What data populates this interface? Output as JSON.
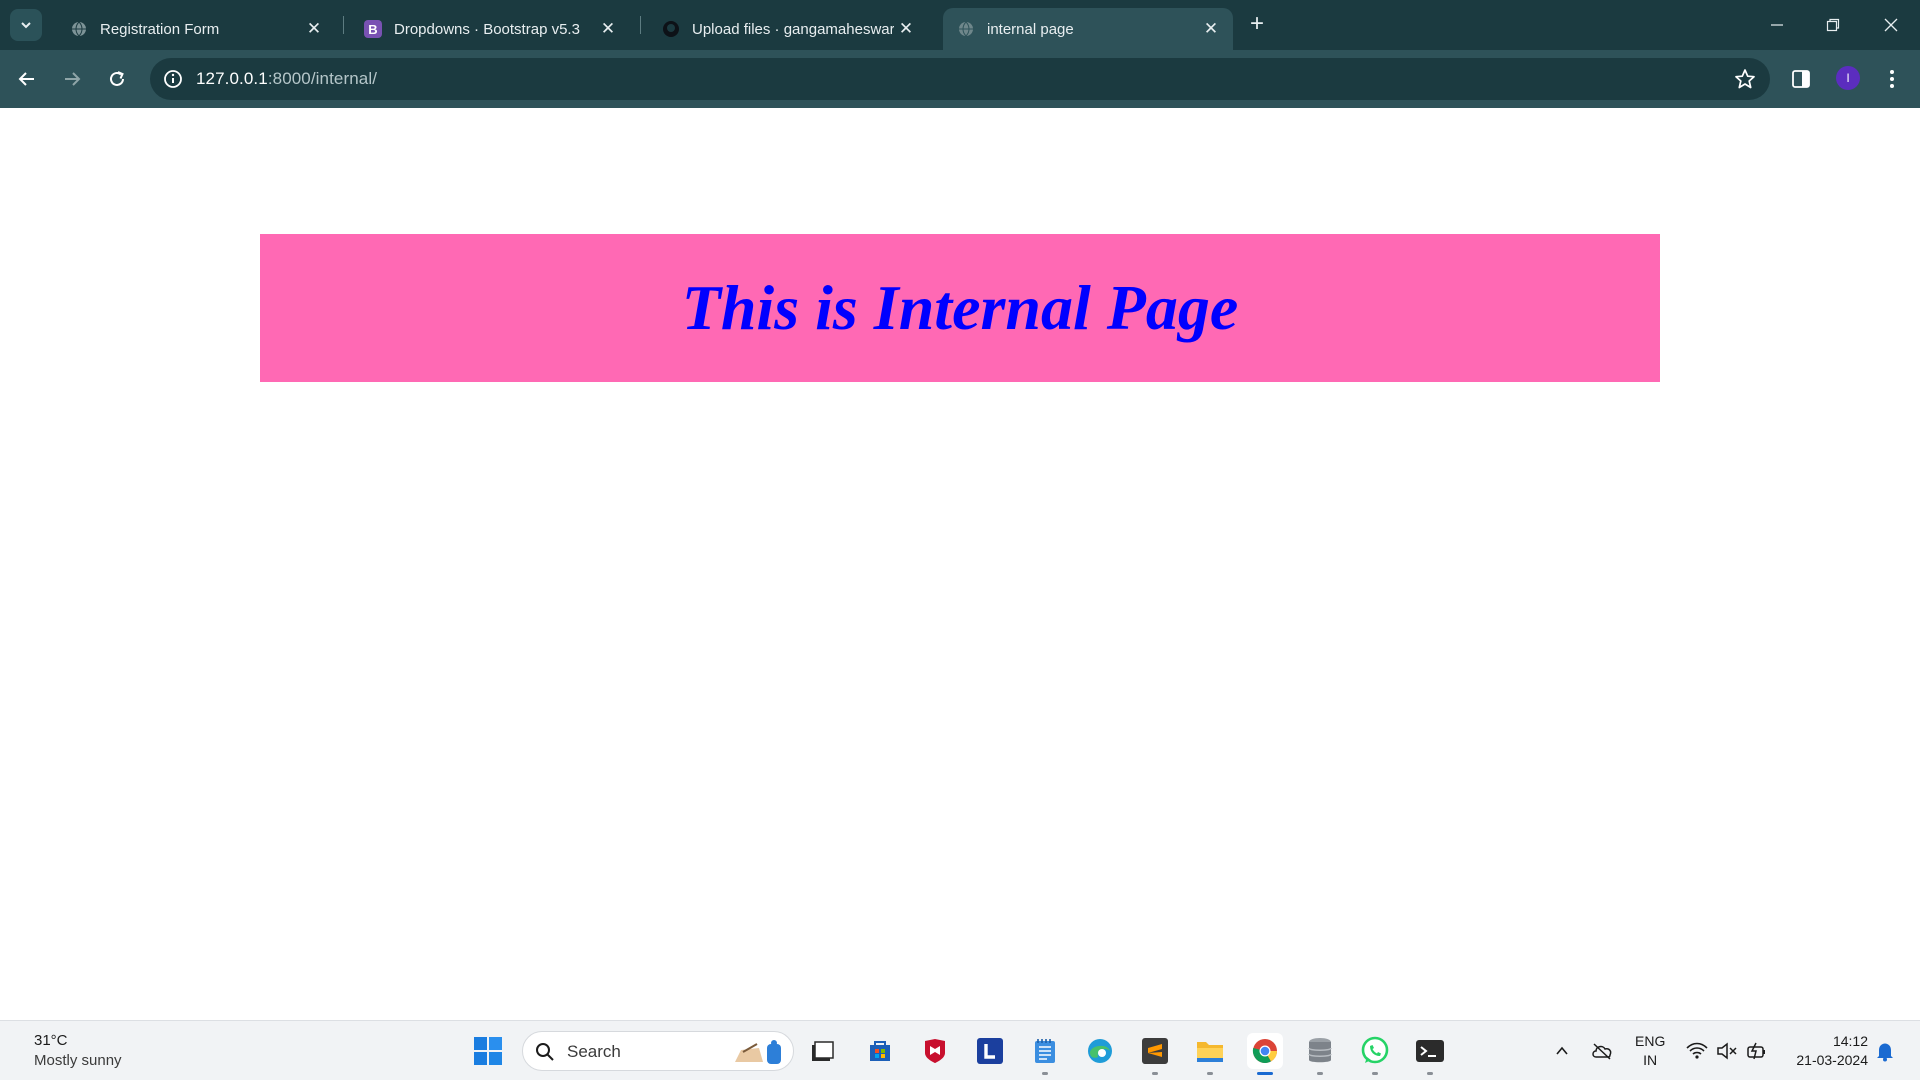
{
  "browser": {
    "tabs": [
      {
        "title": "Registration Form",
        "favicon": "globe-icon",
        "active": false
      },
      {
        "title": "Dropdowns · Bootstrap v5.3",
        "favicon": "bootstrap-icon",
        "favicon_letter": "B",
        "active": false
      },
      {
        "title": "Upload files · gangamaheswari/",
        "favicon": "github-icon",
        "active": false
      },
      {
        "title": "internal page",
        "favicon": "globe-icon",
        "active": true
      }
    ],
    "address": {
      "host": "127.0.0.1",
      "rest": ":8000/internal/"
    },
    "profile_initial": "I",
    "colors": {
      "frame": "#1b3a40",
      "toolbar": "#2e5259"
    }
  },
  "page": {
    "heading": "This is Internal Page",
    "colors": {
      "banner_bg": "#ff69b4",
      "heading": "#0000ff",
      "background": "#ffffff"
    }
  },
  "taskbar": {
    "weather": {
      "temp": "31°C",
      "condition": "Mostly sunny"
    },
    "search_placeholder": "Search",
    "apps": [
      "task-view",
      "microsoft-store",
      "mcafee",
      "l-app",
      "notepad",
      "edge",
      "sublime-text",
      "file-explorer",
      "chrome",
      "database",
      "whatsapp",
      "terminal"
    ],
    "lang": {
      "line1": "ENG",
      "line2": "IN"
    },
    "clock": {
      "time": "14:12",
      "date": "21-03-2024"
    }
  }
}
